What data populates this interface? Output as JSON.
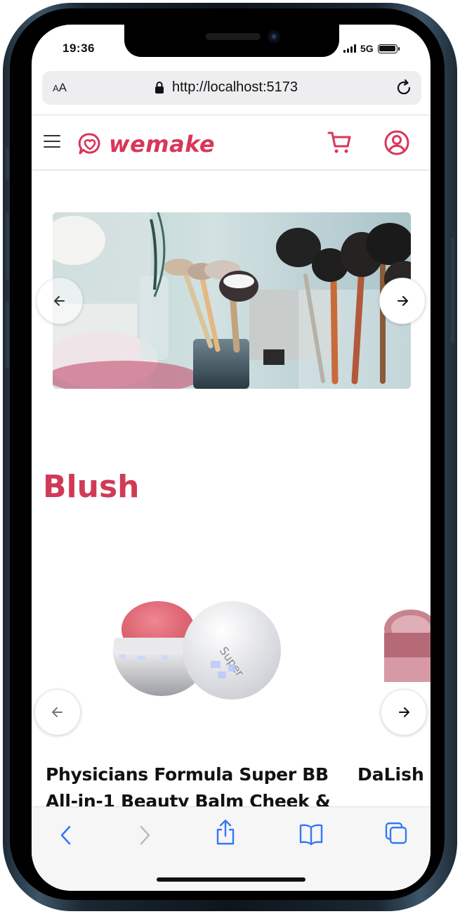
{
  "status_bar": {
    "time": "19:36",
    "network": "5G"
  },
  "browser": {
    "text_size_label": "AA",
    "url": "http://localhost:5173"
  },
  "app": {
    "brand_name": "wemake",
    "brand_color": "#d9365a"
  },
  "hero_carousel": {
    "image_description_icon": "makeup-brushes-photo"
  },
  "section": {
    "title": "Blush"
  },
  "products": [
    {
      "name": "Physicians Formula Super BB All-in-1 Beauty Balm Cheek &"
    },
    {
      "name": "DaLish"
    }
  ],
  "toolbar": {
    "icons": [
      "back-icon",
      "forward-icon",
      "share-icon",
      "bookmarks-icon",
      "tabs-icon"
    ],
    "accent": "#3478f6"
  }
}
